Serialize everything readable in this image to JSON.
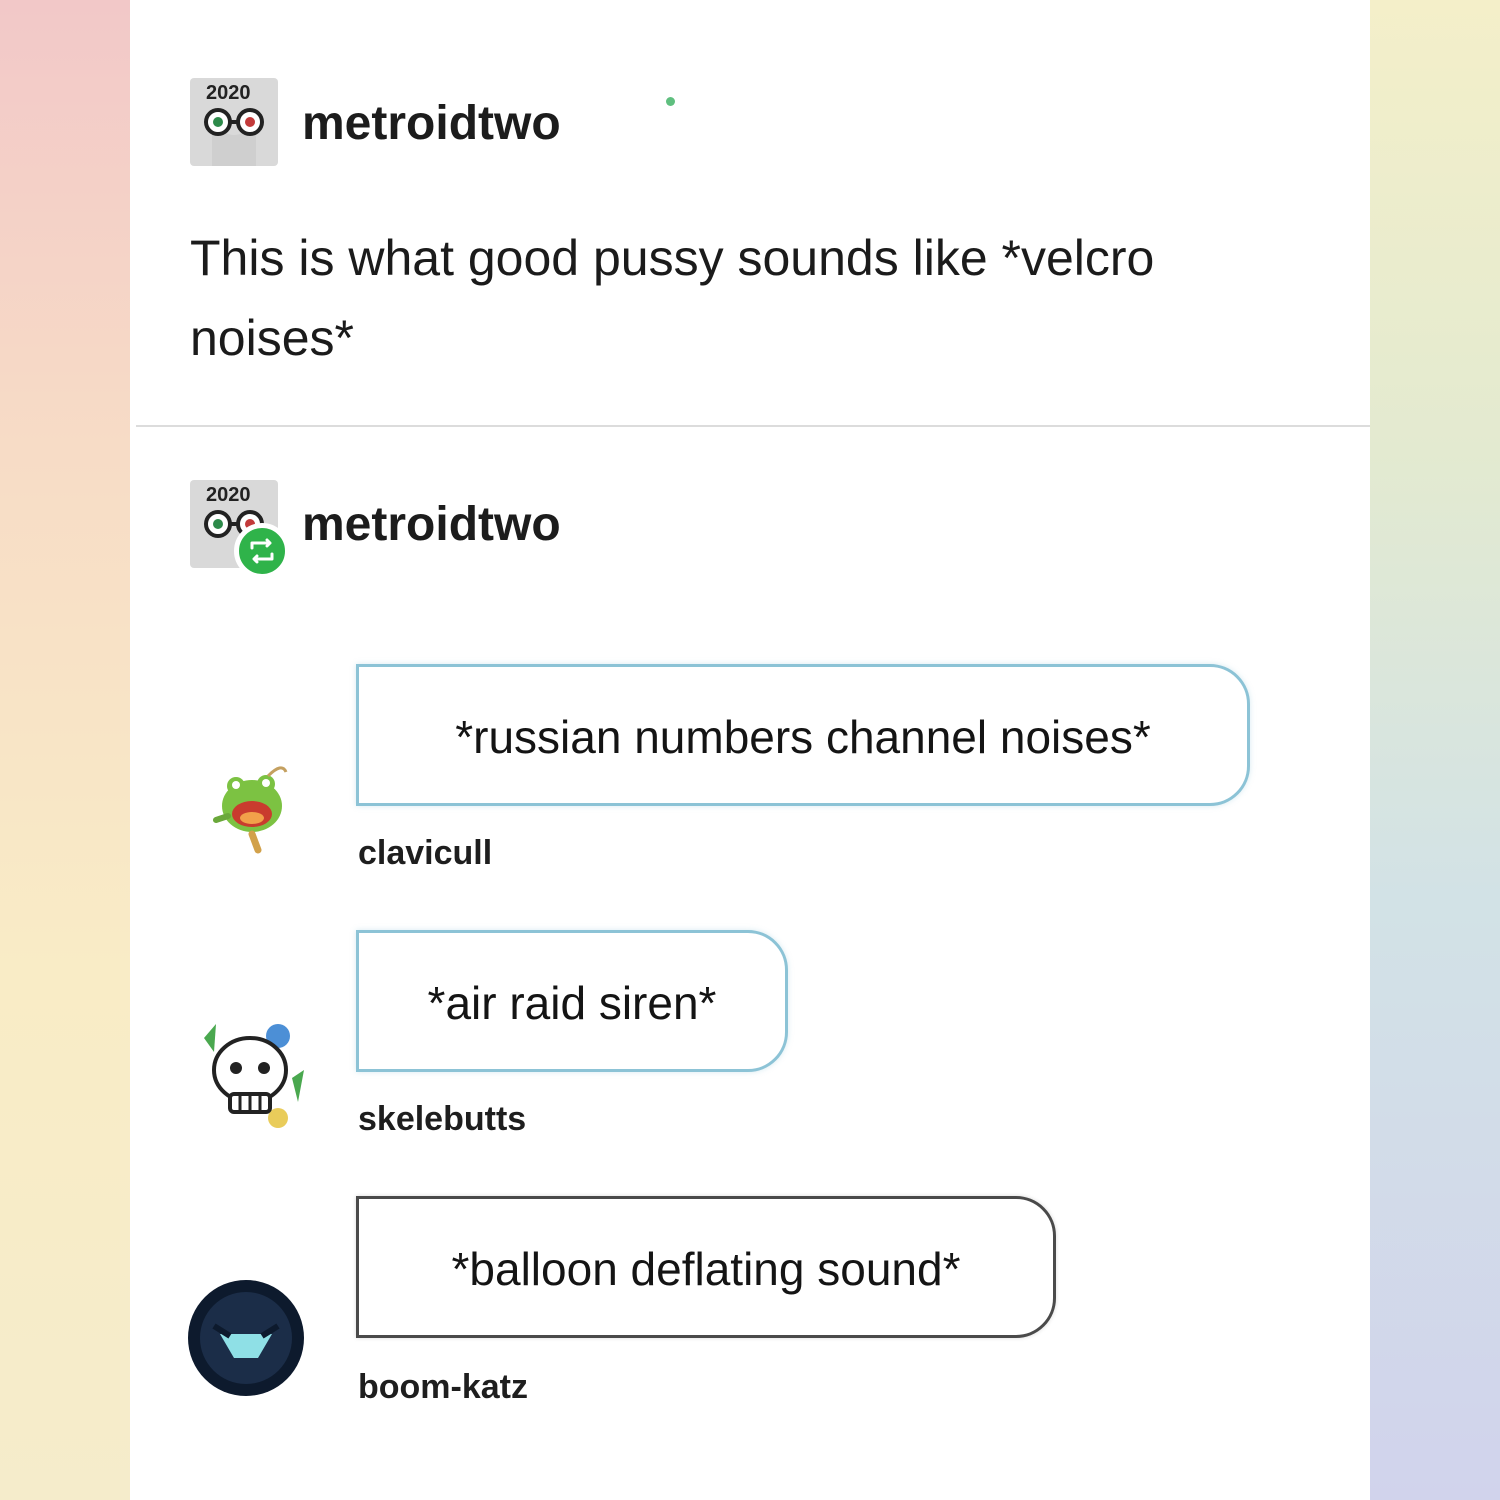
{
  "post": {
    "author": "metroidtwo",
    "avatar_year": "2020",
    "body": "This is what good pussy sounds like *velcro noises*"
  },
  "reblog": {
    "author": "metroidtwo",
    "avatar_year": "2020"
  },
  "replies": [
    {
      "text": "*russian numbers channel noises*",
      "username": "clavicull",
      "avatar": "frog-avatar-icon"
    },
    {
      "text": "*air raid siren*",
      "username": "skelebutts",
      "avatar": "skull-avatar-icon"
    },
    {
      "text": "*balloon deflating sound*",
      "username": "boom-katz",
      "avatar": "dark-helmet-avatar-icon"
    }
  ],
  "colors": {
    "reblog_badge": "#2fb34a",
    "bubble_border": "#8cc3d6",
    "online_dot": "#5fbf7f"
  }
}
